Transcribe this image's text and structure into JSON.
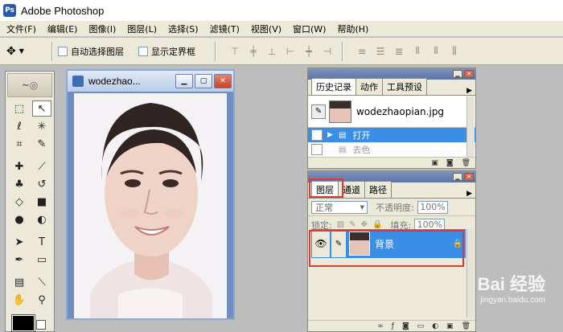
{
  "app": {
    "title": "Adobe Photoshop",
    "icon": "photoshop-icon"
  },
  "menu": [
    "文件(F)",
    "编辑(E)",
    "图像(I)",
    "图层(L)",
    "选择(S)",
    "滤镜(T)",
    "视图(V)",
    "窗口(W)",
    "帮助(H)"
  ],
  "options": {
    "auto_select_label": "自动选择图层",
    "show_bounds_label": "显示定界框"
  },
  "document": {
    "title": "wodezhao..."
  },
  "history_panel": {
    "tabs": [
      "历史记录",
      "动作",
      "工具预设"
    ],
    "snapshot_name": "wodezhaopian.jpg",
    "steps": [
      {
        "label": "打开",
        "selected": true
      },
      {
        "label": "去色",
        "selected": false
      }
    ]
  },
  "layers_panel": {
    "tabs": [
      "图层",
      "通道",
      "路径"
    ],
    "blend_mode": "正常",
    "opacity_label": "不透明度:",
    "opacity_value": "100%",
    "lock_label": "锁定:",
    "fill_label": "填充:",
    "fill_value": "100%",
    "layers": [
      {
        "name": "背景",
        "locked": true,
        "visible": true
      }
    ]
  },
  "watermark": {
    "text": "Bai 经验",
    "sub": "jingyan.baidu.com"
  },
  "colors": {
    "selection": "#3a8ee6",
    "highlight": "#d83a3a",
    "panel_bg": "#ece9d8"
  }
}
